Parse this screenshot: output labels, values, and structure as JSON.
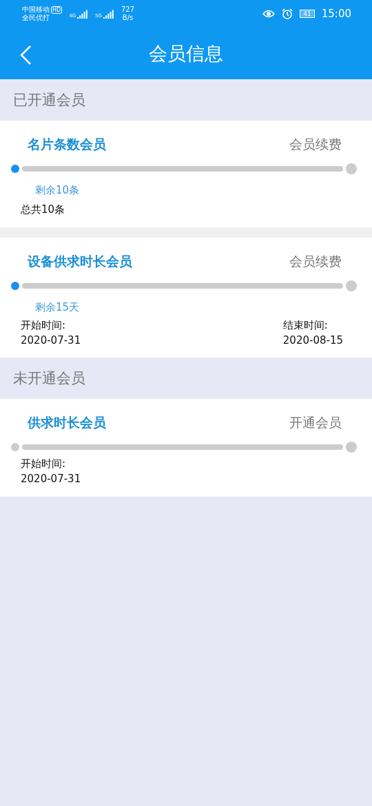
{
  "status_bar": {
    "carrier": "中国移动",
    "hd": "HD",
    "carrier2": "全民优打",
    "net1": "4G",
    "net2": "5G",
    "speed": "727",
    "speed_unit": "B/s",
    "battery": "41",
    "time": "15:00"
  },
  "header": {
    "title": "会员信息"
  },
  "sections": [
    {
      "title": "已开通会员",
      "cards": [
        {
          "name": "名片条数会员",
          "action": "会员续费",
          "active": true,
          "remaining": "剩余10条",
          "total": "总共10条"
        },
        {
          "name": "设备供求时长会员",
          "action": "会员续费",
          "active": true,
          "remaining": "剩余15天",
          "start_label": "开始时间:",
          "start": "2020-07-31",
          "end_label": "结束时间:",
          "end": "2020-08-15"
        }
      ]
    },
    {
      "title": "未开通会员",
      "cards": [
        {
          "name": "供求时长会员",
          "action": "开通会员",
          "active": false,
          "start_label": "开始时间:",
          "start": "2020-07-31"
        }
      ]
    }
  ]
}
